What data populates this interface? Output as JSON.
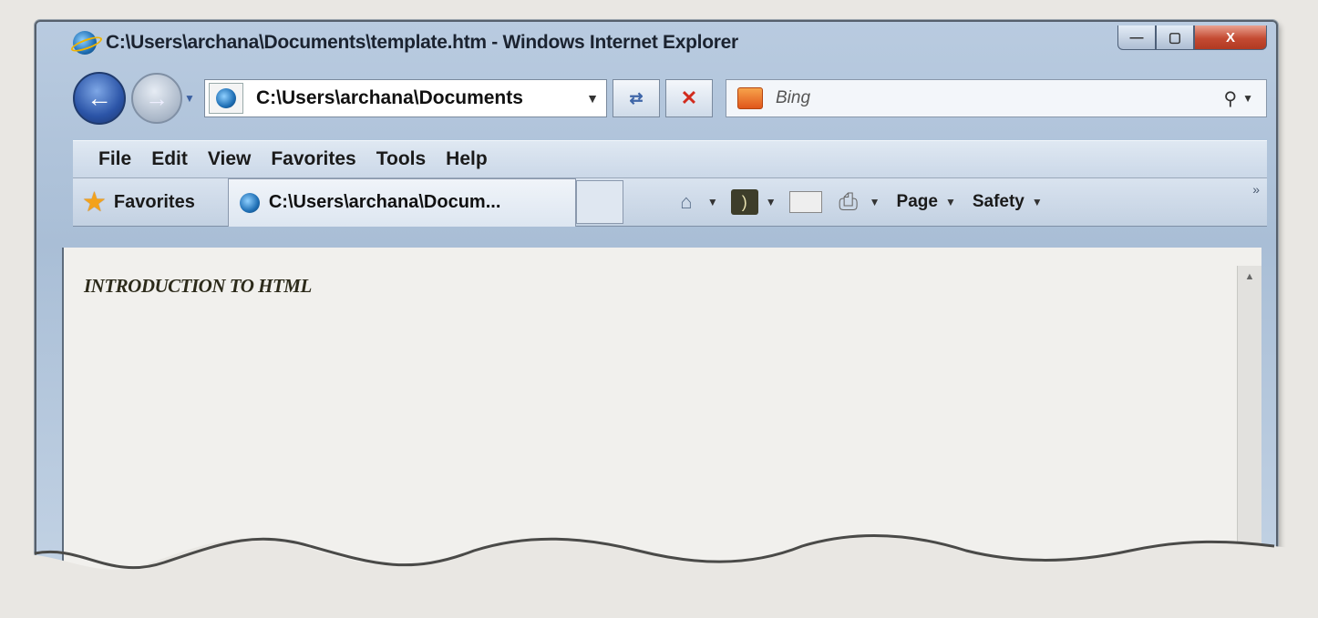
{
  "window": {
    "title": "C:\\Users\\archana\\Documents\\template.htm - Windows Internet Explorer",
    "controls": {
      "minimize": "—",
      "maximize": "▢",
      "close": "X"
    }
  },
  "address_bar": {
    "url": "C:\\Users\\archana\\Documents",
    "back_icon": "back-arrow-icon",
    "forward_icon": "forward-arrow-icon"
  },
  "search": {
    "placeholder": "Bing"
  },
  "menu": [
    "File",
    "Edit",
    "View",
    "Favorites",
    "Tools",
    "Help"
  ],
  "favorites_bar": {
    "favorites_label": "Favorites",
    "tab_title": "C:\\Users\\archana\\Docum...",
    "page_label": "Page",
    "safety_label": "Safety"
  },
  "content": {
    "heading": "INTRODUCTION TO HTML"
  }
}
